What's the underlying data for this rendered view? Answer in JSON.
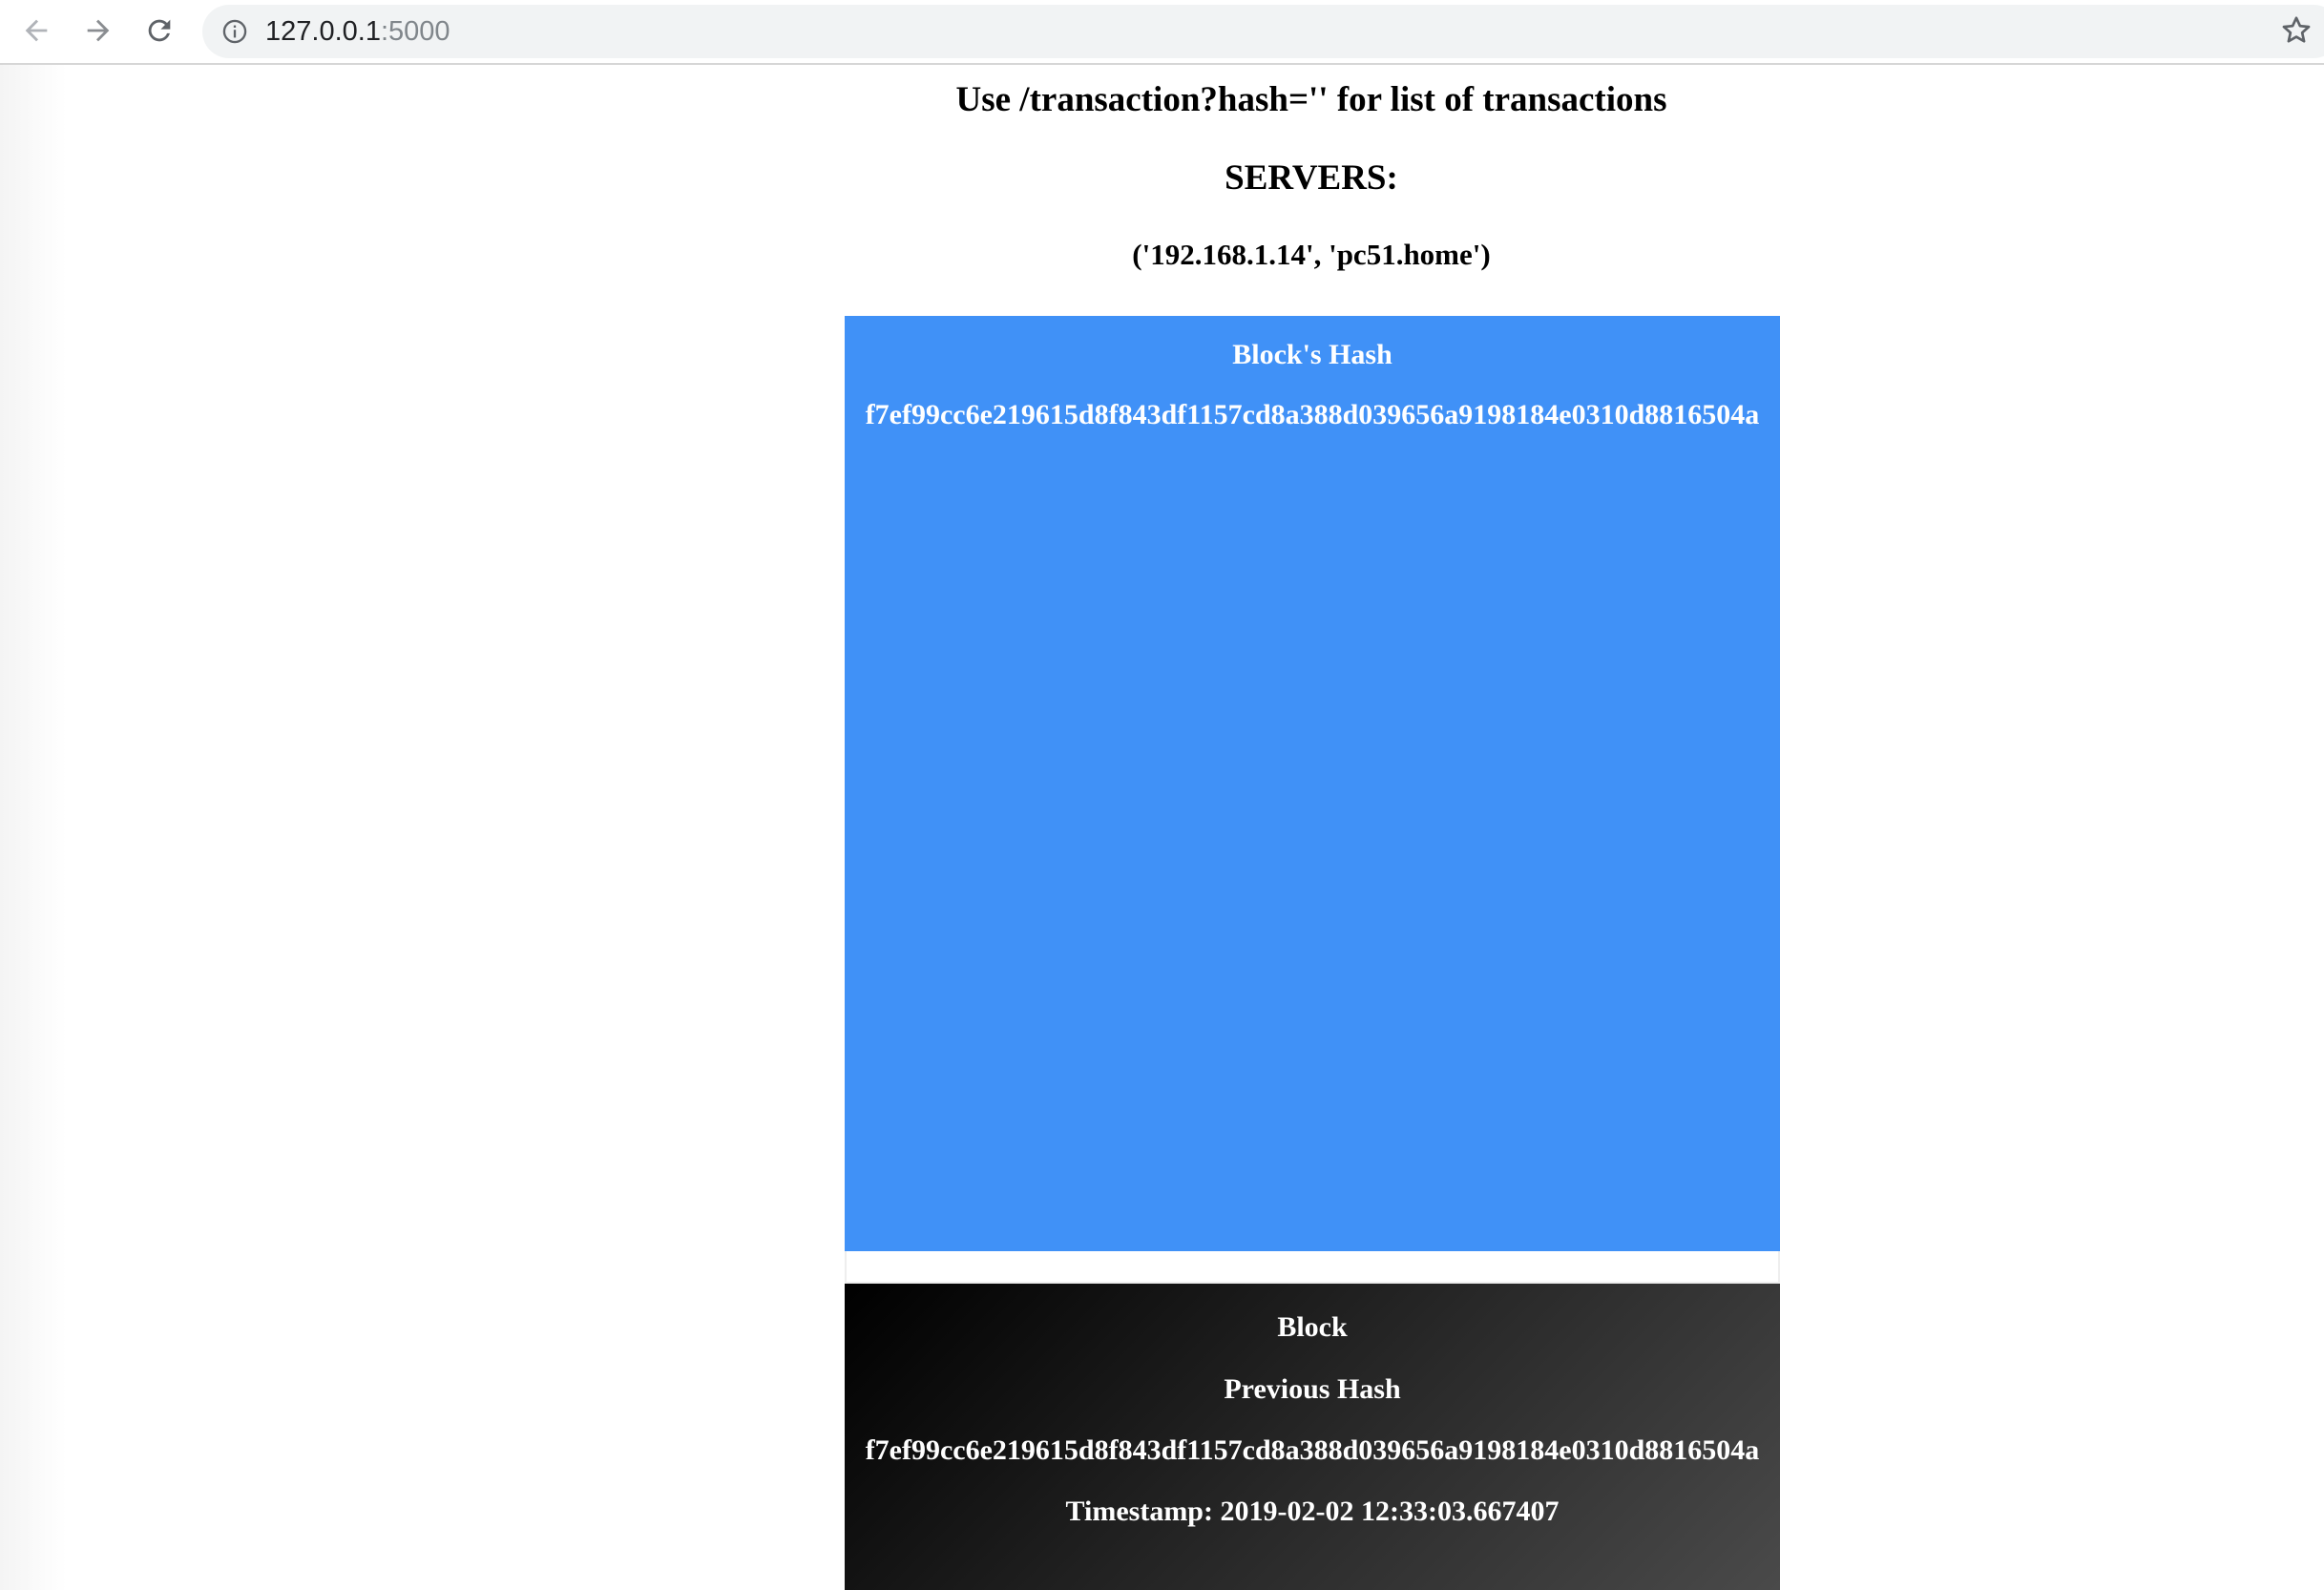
{
  "browser": {
    "back_icon": "arrow-left-icon",
    "forward_icon": "arrow-right-icon",
    "reload_icon": "reload-icon",
    "info_icon": "info-circle-icon",
    "bookmark_icon": "star-outline-icon",
    "url_host": "127.0.0.1",
    "url_port": ":5000"
  },
  "page": {
    "usage_text": "Use /transaction?hash='' for list of transactions",
    "servers_heading": "SERVERS:",
    "server_item": "('192.168.1.14', 'pc51.home')"
  },
  "hash_card": {
    "title": "Block's Hash",
    "hash": "f7ef99cc6e219615d8f843df1157cd8a388d039656a9198184e0310d8816504a",
    "color": "#4091f7"
  },
  "block_card": {
    "title": "Block",
    "previous_hash_label": "Previous Hash",
    "previous_hash": "f7ef99cc6e219615d8f843df1157cd8a388d039656a9198184e0310d8816504a",
    "timestamp": "Timestamp: 2019-02-02 12:33:03.667407"
  }
}
